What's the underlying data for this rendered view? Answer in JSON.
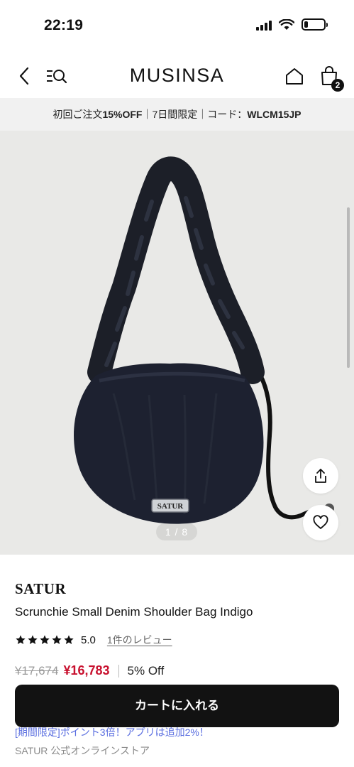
{
  "status_bar": {
    "time": "22:19",
    "battery_level": 0.2
  },
  "header": {
    "logo": "MUSINSA",
    "cart_count": "2"
  },
  "promo_banner": {
    "part1": "初回ご注文",
    "highlight": "15%OFF",
    "part2": "｜7日間限定｜コード：",
    "code": "WLCM15JP"
  },
  "gallery": {
    "counter": "1 / 8",
    "product_logo": "SATUR"
  },
  "product": {
    "brand": "SATUR",
    "title": "Scrunchie Small Denim Shoulder Bag Indigo",
    "rating_stars": 5,
    "rating_value": "5.0",
    "review_link": "1件のレビュー",
    "original_price": "¥17,674",
    "sale_price": "¥16,783",
    "discount": "5% Off"
  },
  "actions": {
    "add_to_cart": "カートに入れる"
  },
  "promo_note": "[期間限定]ポイント3倍！アプリは追加2%！",
  "store_name": "SATUR 公式オンラインストア",
  "colors": {
    "accent_dark": "#121212",
    "sale_red": "#c8102e",
    "promo_bg": "#f1f1f1",
    "link_blue": "#5a6ee0"
  }
}
